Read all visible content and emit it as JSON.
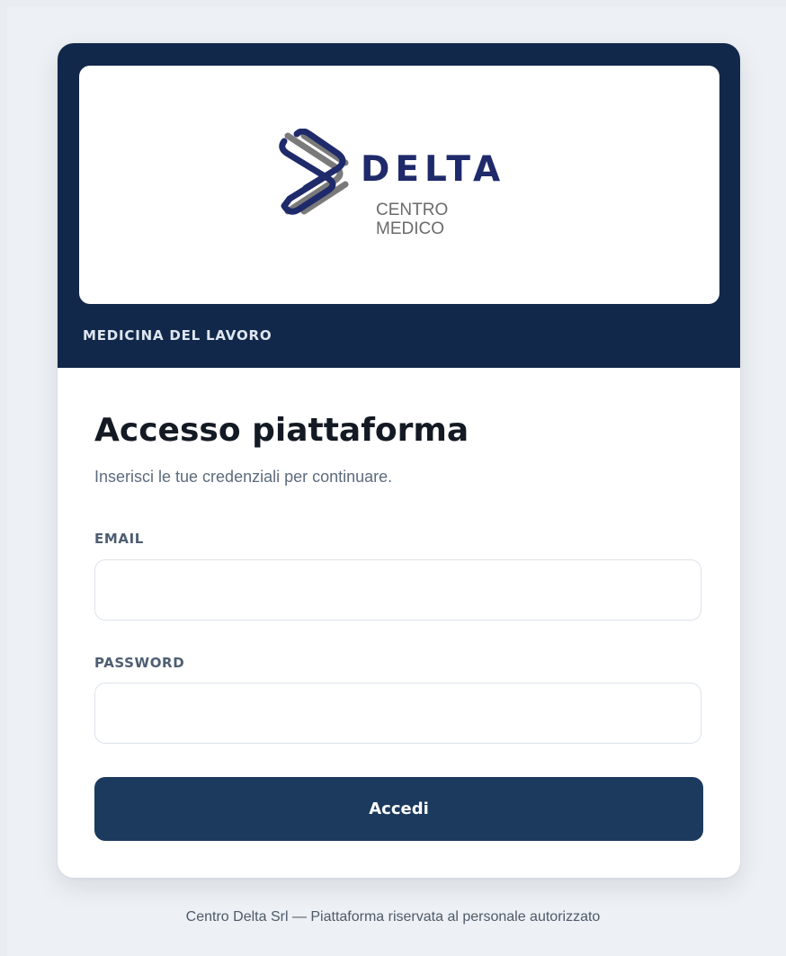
{
  "brand": {
    "logo_word": "DELTA",
    "logo_sub_line1": "CENTRO",
    "logo_sub_line2": "MEDICO",
    "header_caption": "MEDICINA DEL LAVORO",
    "colors": {
      "header_bg": "#12284a",
      "logo_blue": "#1f2a6b",
      "logo_gray": "#6b6b6b",
      "button_bg": "#1c3a5e"
    }
  },
  "login": {
    "title": "Accesso piattaforma",
    "subtitle": "Inserisci le tue credenziali per continuare.",
    "email_label": "EMAIL",
    "email_value": "",
    "password_label": "PASSWORD",
    "password_value": "",
    "submit_label": "Accedi"
  },
  "footer": {
    "note": "Centro Delta Srl — Piattaforma riservata al personale autorizzato"
  }
}
